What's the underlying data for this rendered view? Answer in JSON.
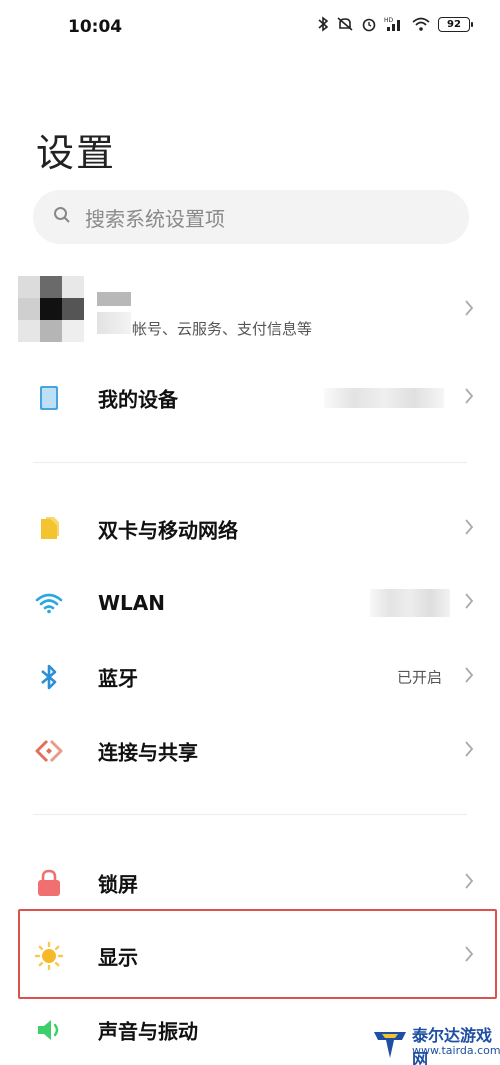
{
  "status_bar": {
    "time": "10:04",
    "battery": "92",
    "icons": [
      "bluetooth-icon",
      "mute-icon",
      "alarm-icon",
      "signal-icon",
      "wifi-icon",
      "battery-icon"
    ]
  },
  "page": {
    "title": "设置"
  },
  "search": {
    "placeholder": "搜索系统设置项",
    "icon": "search-icon"
  },
  "account": {
    "subtitle": "帐号、云服务、支付信息等"
  },
  "items": [
    {
      "label": "我的设备",
      "icon": "device-icon",
      "value": ""
    },
    {
      "label": "双卡与移动网络",
      "icon": "sim-card-icon",
      "value": ""
    },
    {
      "label": "WLAN",
      "icon": "wifi-icon",
      "value": ""
    },
    {
      "label": "蓝牙",
      "icon": "bluetooth-icon",
      "value": "已开启"
    },
    {
      "label": "连接与共享",
      "icon": "connection-share-icon",
      "value": ""
    },
    {
      "label": "锁屏",
      "icon": "lock-icon",
      "value": ""
    },
    {
      "label": "显示",
      "icon": "sun-icon",
      "value": ""
    },
    {
      "label": "声音与振动",
      "icon": "speaker-icon",
      "value": ""
    }
  ],
  "colors": {
    "highlight_border": "#d9534f",
    "device_icon": "#4aa3df",
    "sim_icon": "#f4c430",
    "wifi_icon": "#2aa7e0",
    "bluetooth_icon": "#2b8fd6",
    "share_icon": "#e0705a",
    "lock_icon": "#f07070",
    "sun_icon": "#f6b928",
    "speaker_icon": "#3ccf6a"
  },
  "watermark": {
    "line1": "泰尔达游戏网",
    "line2": "www.tairda.com"
  }
}
